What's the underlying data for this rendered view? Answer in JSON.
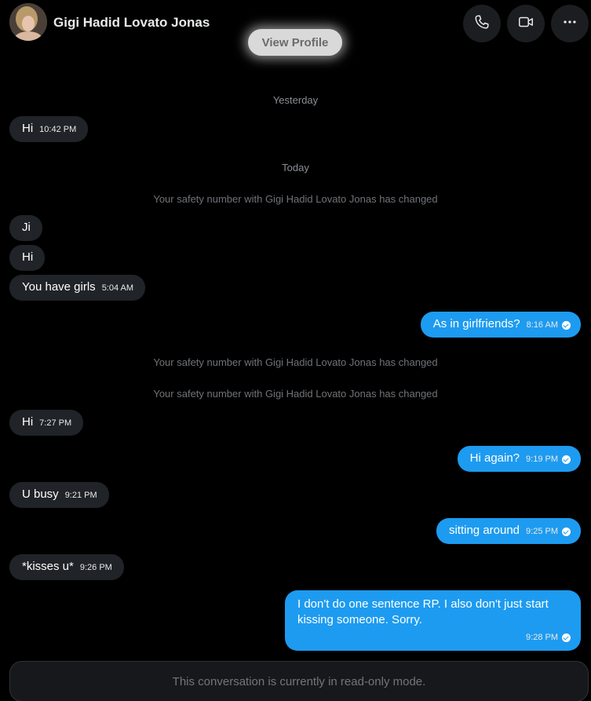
{
  "header": {
    "contact_name": "Gigi Hadid Lovato Jonas",
    "view_profile_label": "View Profile"
  },
  "dividers": {
    "yesterday": "Yesterday",
    "today": "Today"
  },
  "system_notice": "Your safety number with Gigi Hadid Lovato Jonas has changed",
  "messages": [
    {
      "dir": "in",
      "text": "Hi",
      "time": "10:42 PM"
    },
    {
      "dir": "in",
      "text": "Ji",
      "time": ""
    },
    {
      "dir": "in",
      "text": "Hi",
      "time": ""
    },
    {
      "dir": "in",
      "text": "You have girls",
      "time": "5:04 AM"
    },
    {
      "dir": "out",
      "text": "As in girlfriends?",
      "time": "8:16 AM",
      "read": true
    },
    {
      "dir": "in",
      "text": "Hi",
      "time": "7:27 PM"
    },
    {
      "dir": "out",
      "text": "Hi again?",
      "time": "9:19 PM",
      "read": true
    },
    {
      "dir": "in",
      "text": "U busy",
      "time": "9:21 PM"
    },
    {
      "dir": "out",
      "text": "sitting around",
      "time": "9:25 PM",
      "read": true
    },
    {
      "dir": "in",
      "text": "*kisses u*",
      "time": "9:26 PM"
    },
    {
      "dir": "out",
      "text": "I don't do one sentence RP. I also don't just start kissing someone. Sorry.",
      "time": "9:28 PM",
      "read": true
    }
  ],
  "footer": {
    "readonly_text": "This conversation is currently in read-only mode."
  },
  "icons": {
    "call": "phone-icon",
    "video": "video-icon",
    "more": "more-icon"
  },
  "colors": {
    "outgoing_bubble": "#1d9bf0",
    "incoming_bubble": "#202327",
    "background": "#000000"
  }
}
